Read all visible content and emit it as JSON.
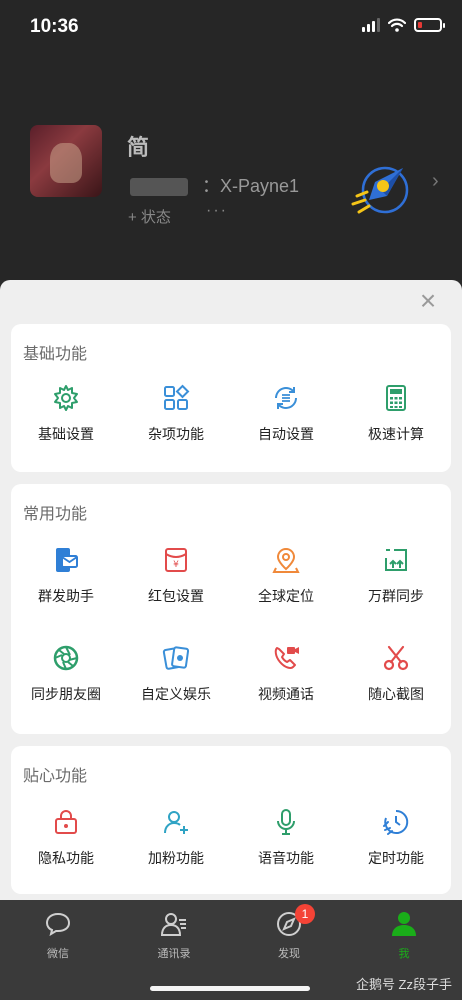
{
  "status_bar": {
    "time": "10:36"
  },
  "profile": {
    "name": "简",
    "id_text": "：X-Payne1",
    "status_label": "+ 状态",
    "more": "···",
    "arrow": "›"
  },
  "sheet": {
    "close": "×",
    "sections": [
      {
        "title": "基础功能",
        "items": [
          {
            "label": "基础设置",
            "icon": "gear-icon",
            "color": "#2e9e6b"
          },
          {
            "label": "杂项功能",
            "icon": "apps-icon",
            "color": "#3a8fd8"
          },
          {
            "label": "自动设置",
            "icon": "refresh-list-icon",
            "color": "#3a8fd8"
          },
          {
            "label": "极速计算",
            "icon": "calculator-icon",
            "color": "#2e9e6b"
          }
        ]
      },
      {
        "title": "常用功能",
        "items": [
          {
            "label": "群发助手",
            "icon": "phone-mail-icon",
            "color": "#2f7fd6"
          },
          {
            "label": "红包设置",
            "icon": "red-packet-icon",
            "color": "#e24b4b"
          },
          {
            "label": "全球定位",
            "icon": "map-pin-icon",
            "color": "#f0893a"
          },
          {
            "label": "万群同步",
            "icon": "sync-upload-icon",
            "color": "#2e9e6b"
          },
          {
            "label": "同步朋友圈",
            "icon": "aperture-icon",
            "color": "#2e9e6b"
          },
          {
            "label": "自定义娱乐",
            "icon": "cards-icon",
            "color": "#3a8fd8"
          },
          {
            "label": "视频通话",
            "icon": "video-call-icon",
            "color": "#e24b4b"
          },
          {
            "label": "随心截图",
            "icon": "scissors-icon",
            "color": "#e24b4b"
          }
        ]
      },
      {
        "title": "贴心功能",
        "items": [
          {
            "label": "隐私功能",
            "icon": "lock-icon",
            "color": "#e24b4b"
          },
          {
            "label": "加粉功能",
            "icon": "add-user-icon",
            "color": "#2fa3c4"
          },
          {
            "label": "语音功能",
            "icon": "microphone-icon",
            "color": "#2e9e6b"
          },
          {
            "label": "定时功能",
            "icon": "timer-icon",
            "color": "#2f7fd6"
          }
        ]
      }
    ]
  },
  "tabbar": {
    "tabs": [
      {
        "label": "微信",
        "icon": "chat-icon"
      },
      {
        "label": "通讯录",
        "icon": "contacts-icon"
      },
      {
        "label": "发现",
        "icon": "compass-icon",
        "badge": "1"
      },
      {
        "label": "我",
        "icon": "person-icon",
        "active": true
      }
    ],
    "watermark": "企鹅号 Zz段子手"
  }
}
